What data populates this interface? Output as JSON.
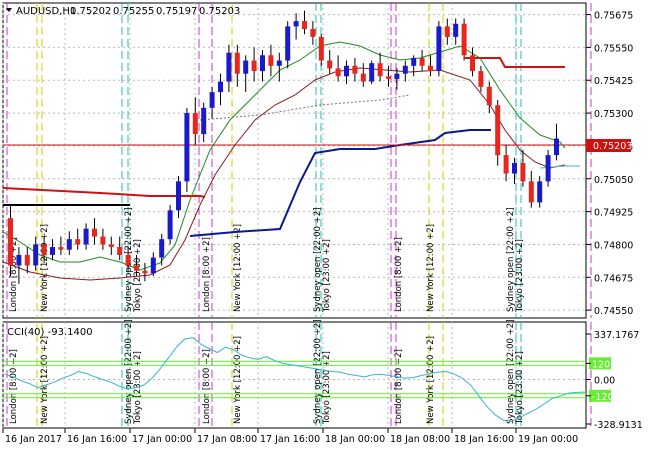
{
  "symbol_header": "AUDUSD,H1",
  "ohlc": {
    "open": "0.75202",
    "high": "0.75255",
    "low": "0.75197",
    "close": "0.75203"
  },
  "indicator_header": "CCI(40) -93.1400",
  "current_price_tag": "0.75203",
  "price_axis_labels": [
    "0.75675",
    "0.75550",
    "0.75425",
    "0.75300",
    "0.75175",
    "0.75050",
    "0.74925",
    "0.74800",
    "0.74675",
    "0.74550"
  ],
  "cci_axis_labels": [
    "337.1767",
    "120",
    "0.00",
    "-120",
    "-328.9131"
  ],
  "cci_levels": {
    "top": 337.1767,
    "upper": 120,
    "zero": 0,
    "lower": -120,
    "bottom": -328.9131
  },
  "time_axis_labels": [
    "16 Jan 2017",
    "16 Jan 16:00",
    "17 Jan 00:00",
    "17 Jan 08:00",
    "17 Jan 16:00",
    "18 Jan 00:00",
    "18 Jan 08:00",
    "18 Jan 16:00",
    "19 Jan 00:00"
  ],
  "session_labels": {
    "london": "London  [8:00 +2]",
    "newyork": "New York  [12:00 +2]",
    "sydney": "Sydney open [22:00 +2]",
    "tokyo": "Tokyo  [23:00 +2]"
  },
  "colors": {
    "bull_candle": "#1a1acc",
    "bear_candle": "#e8261e",
    "ma_fast": "#1f8a1f",
    "ma_slow": "#8b1a1a",
    "support_line": "#0a1a8c",
    "resistance_line": "#d11111",
    "cci_line": "#39b3d6",
    "cci_level": "#66ee33",
    "price_line": "#cc1111",
    "london_marker": "#cc33cc",
    "newyork_marker": "#d8c800",
    "asia_marker": "#22bbbb"
  }
}
